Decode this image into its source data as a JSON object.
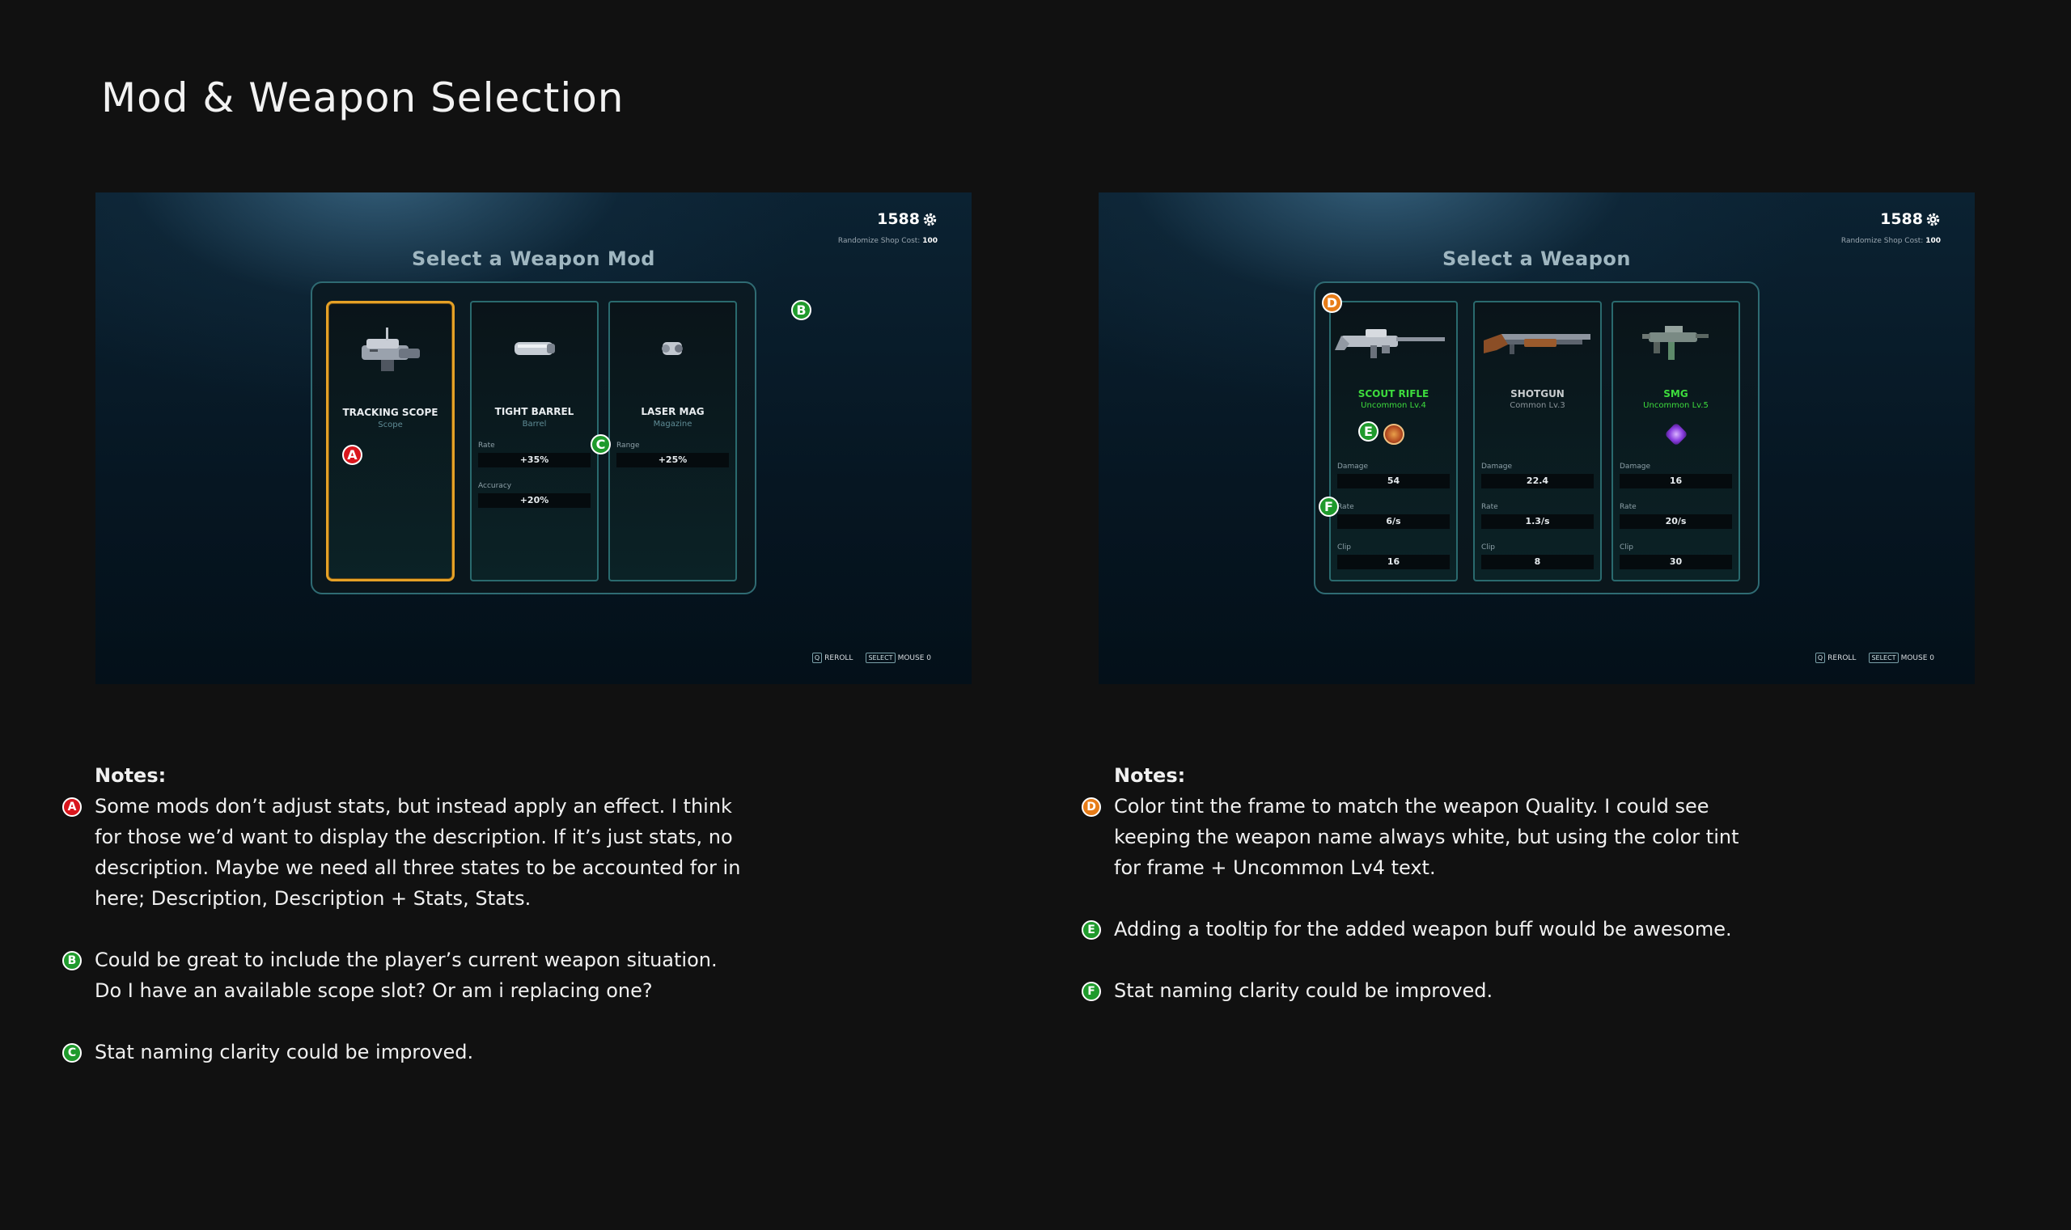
{
  "page_title": "Mod & Weapon Selection",
  "colors": {
    "selected_border": "#e5a126",
    "uncommon_green": "#3ddc3d",
    "common_gray": "#c8ccce",
    "marker_red": "#d9161d",
    "marker_green": "#1f9a2c",
    "marker_orange": "#e77c18"
  },
  "mod_screen": {
    "currency": "1588",
    "currency_icon": "gear-icon",
    "reroll_cost_label": "Randomize Shop Cost:",
    "reroll_cost_value": "100",
    "title": "Select a Weapon Mod",
    "cards": [
      {
        "name": "TRACKING SCOPE",
        "type": "Scope",
        "selected": true,
        "stats": []
      },
      {
        "name": "TIGHT BARREL",
        "type": "Barrel",
        "selected": false,
        "stats": [
          {
            "label": "Rate",
            "value": "+35%"
          },
          {
            "label": "Accuracy",
            "value": "+20%"
          }
        ]
      },
      {
        "name": "LASER MAG",
        "type": "Magazine",
        "selected": false,
        "stats": [
          {
            "label": "Range",
            "value": "+25%"
          }
        ]
      }
    ],
    "footer": {
      "reroll_key": "Q",
      "reroll_label": "REROLL",
      "select_key": "SELECT",
      "select_label": "MOUSE 0"
    },
    "markers": {
      "a": "A",
      "b": "B",
      "c": "C"
    }
  },
  "weapon_screen": {
    "currency": "1588",
    "currency_icon": "gear-icon",
    "reroll_cost_label": "Randomize Shop Cost:",
    "reroll_cost_value": "100",
    "title": "Select a Weapon",
    "cards": [
      {
        "name": "SCOUT RIFLE",
        "rarity": "Uncommon Lv.4",
        "quality": "uncommon",
        "stats": [
          {
            "label": "Damage",
            "value": "54"
          },
          {
            "label": "Rate",
            "value": "6/s"
          },
          {
            "label": "Clip",
            "value": "16"
          }
        ]
      },
      {
        "name": "SHOTGUN",
        "rarity": "Common Lv.3",
        "quality": "common",
        "stats": [
          {
            "label": "Damage",
            "value": "22.4"
          },
          {
            "label": "Rate",
            "value": "1.3/s"
          },
          {
            "label": "Clip",
            "value": "8"
          }
        ]
      },
      {
        "name": "SMG",
        "rarity": "Uncommon Lv.5",
        "quality": "uncommon",
        "stats": [
          {
            "label": "Damage",
            "value": "16"
          },
          {
            "label": "Rate",
            "value": "20/s"
          },
          {
            "label": "Clip",
            "value": "30"
          }
        ]
      }
    ],
    "footer": {
      "reroll_key": "Q",
      "reroll_label": "REROLL",
      "select_key": "SELECT",
      "select_label": "MOUSE 0"
    },
    "markers": {
      "d": "D",
      "e": "E",
      "f": "F"
    }
  },
  "notes_left": {
    "heading": "Notes:",
    "items": [
      {
        "badge": "A",
        "text": "Some mods don’t adjust stats, but instead apply an effect. I think for those we’d want to display the description. If it’s just stats, no description. Maybe we need all three states to be accounted for in here; Description, Description + Stats, Stats."
      },
      {
        "badge": "B",
        "text": "Could be great to include the player’s current weapon situation. Do I have an available scope slot? Or am i replacing one?"
      },
      {
        "badge": "C",
        "text": "Stat naming clarity could be improved."
      }
    ]
  },
  "notes_right": {
    "heading": "Notes:",
    "items": [
      {
        "badge": "D",
        "text": "Color tint the frame to match the weapon Quality. I could see keeping the weapon name always white, but using the color tint for frame + Uncommon Lv4 text."
      },
      {
        "badge": "E",
        "text": "Adding a tooltip for the added weapon buff would be awesome."
      },
      {
        "badge": "F",
        "text": "Stat naming clarity could be improved."
      }
    ]
  }
}
